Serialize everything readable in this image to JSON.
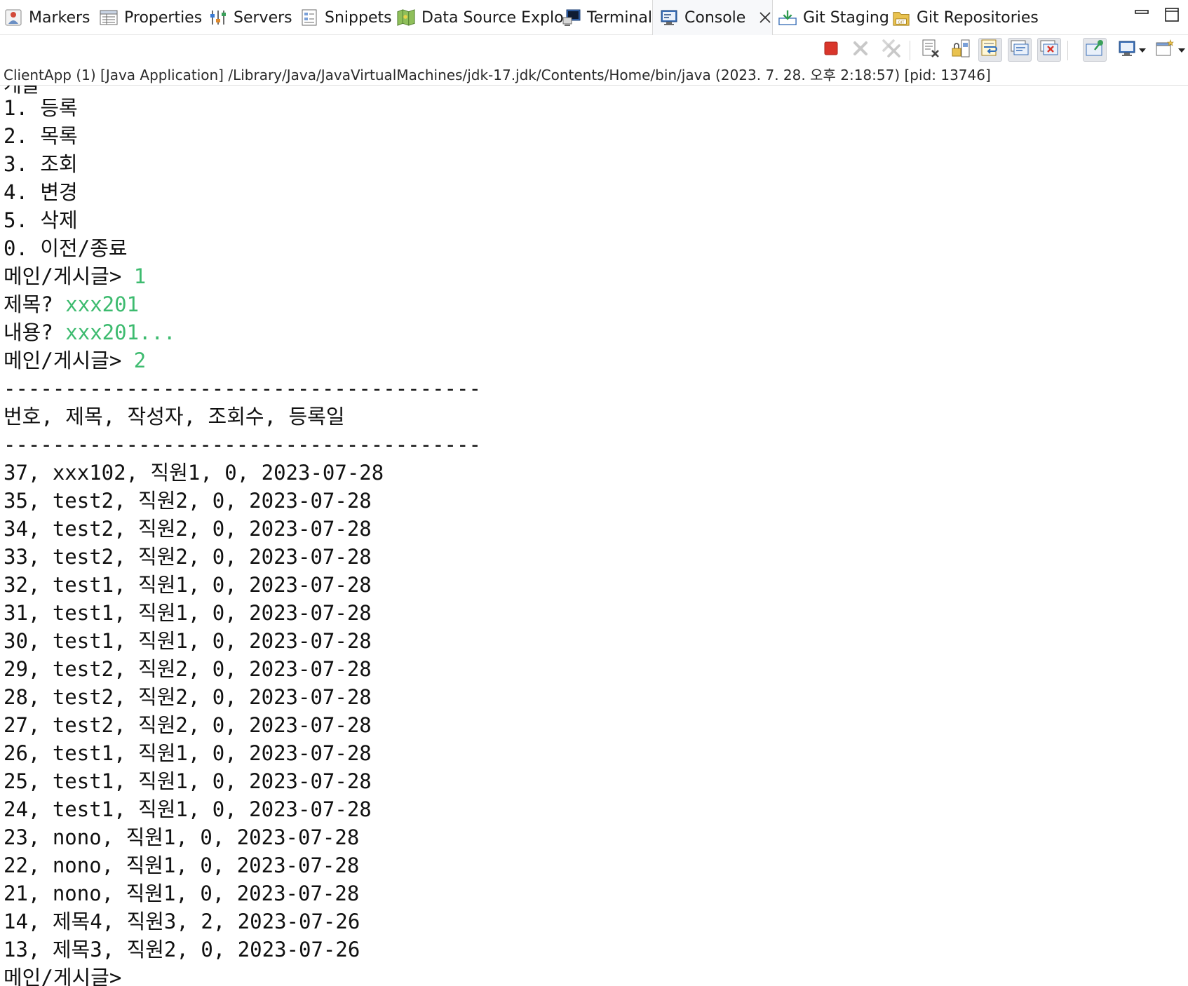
{
  "tabs": [
    {
      "label": "Markers",
      "icon": "markers-icon"
    },
    {
      "label": "Properties",
      "icon": "properties-icon"
    },
    {
      "label": "Servers",
      "icon": "servers-icon"
    },
    {
      "label": "Snippets",
      "icon": "snippets-icon"
    },
    {
      "label": "Data Source Explo",
      "icon": "data-source-explorer-icon"
    },
    {
      "label": "Terminal",
      "icon": "terminal-icon"
    },
    {
      "label": "Console",
      "icon": "console-icon",
      "active": true
    },
    {
      "label": "Git Staging",
      "icon": "git-staging-icon"
    },
    {
      "label": "Git Repositories",
      "icon": "git-repositories-icon"
    }
  ],
  "toolbar": {
    "buttons": [
      {
        "name": "terminate-icon",
        "color": "#d9362b"
      },
      {
        "name": "remove-launch-icon",
        "color": "#c8c8c8"
      },
      {
        "name": "remove-all-terminated-icon",
        "color": "#c8c8c8"
      },
      {
        "name": "clear-console-icon"
      },
      {
        "name": "scroll-lock-icon"
      },
      {
        "name": "word-wrap-icon"
      },
      {
        "name": "show-console-on-stdout-icon"
      },
      {
        "name": "show-console-on-stderr-icon"
      },
      {
        "name": "pin-console-icon"
      },
      {
        "name": "display-selected-console-icon"
      },
      {
        "name": "open-console-icon"
      }
    ]
  },
  "launch": {
    "description": "ClientApp (1) [Java Application] /Library/Java/JavaVirtualMachines/jdk-17.jdk/Contents/Home/bin/java  (2023. 7. 28. 오후 2:18:57) [pid: 13746]"
  },
  "console": {
    "input_color": "#3dbb6f",
    "top_fragment": "게글",
    "lines": [
      {
        "text": "1. 등록"
      },
      {
        "text": "2. 목록"
      },
      {
        "text": "3. 조회"
      },
      {
        "text": "4. 변경"
      },
      {
        "text": "5. 삭제"
      },
      {
        "text": "0. 이전/종료"
      },
      {
        "text": "메인/게시글> ",
        "input": "1"
      },
      {
        "text": "제목? ",
        "input": "xxx201"
      },
      {
        "text": "내용? ",
        "input": "xxx201..."
      },
      {
        "text": "메인/게시글> ",
        "input": "2"
      },
      {
        "text": "---------------------------------------"
      },
      {
        "text": "번호, 제목, 작성자, 조회수, 등록일"
      },
      {
        "text": "---------------------------------------"
      },
      {
        "text": "37, xxx102, 직원1, 0, 2023-07-28"
      },
      {
        "text": "35, test2, 직원2, 0, 2023-07-28"
      },
      {
        "text": "34, test2, 직원2, 0, 2023-07-28"
      },
      {
        "text": "33, test2, 직원2, 0, 2023-07-28"
      },
      {
        "text": "32, test1, 직원1, 0, 2023-07-28"
      },
      {
        "text": "31, test1, 직원1, 0, 2023-07-28"
      },
      {
        "text": "30, test1, 직원1, 0, 2023-07-28"
      },
      {
        "text": "29, test2, 직원2, 0, 2023-07-28"
      },
      {
        "text": "28, test2, 직원2, 0, 2023-07-28"
      },
      {
        "text": "27, test2, 직원2, 0, 2023-07-28"
      },
      {
        "text": "26, test1, 직원1, 0, 2023-07-28"
      },
      {
        "text": "25, test1, 직원1, 0, 2023-07-28"
      },
      {
        "text": "24, test1, 직원1, 0, 2023-07-28"
      },
      {
        "text": "23, nono, 직원1, 0, 2023-07-28"
      },
      {
        "text": "22, nono, 직원1, 0, 2023-07-28"
      },
      {
        "text": "21, nono, 직원1, 0, 2023-07-28"
      },
      {
        "text": "14, 제목4, 직원3, 2, 2023-07-26"
      },
      {
        "text": "13, 제목3, 직원2, 0, 2023-07-26"
      },
      {
        "text": "메인/게시글>"
      }
    ]
  }
}
